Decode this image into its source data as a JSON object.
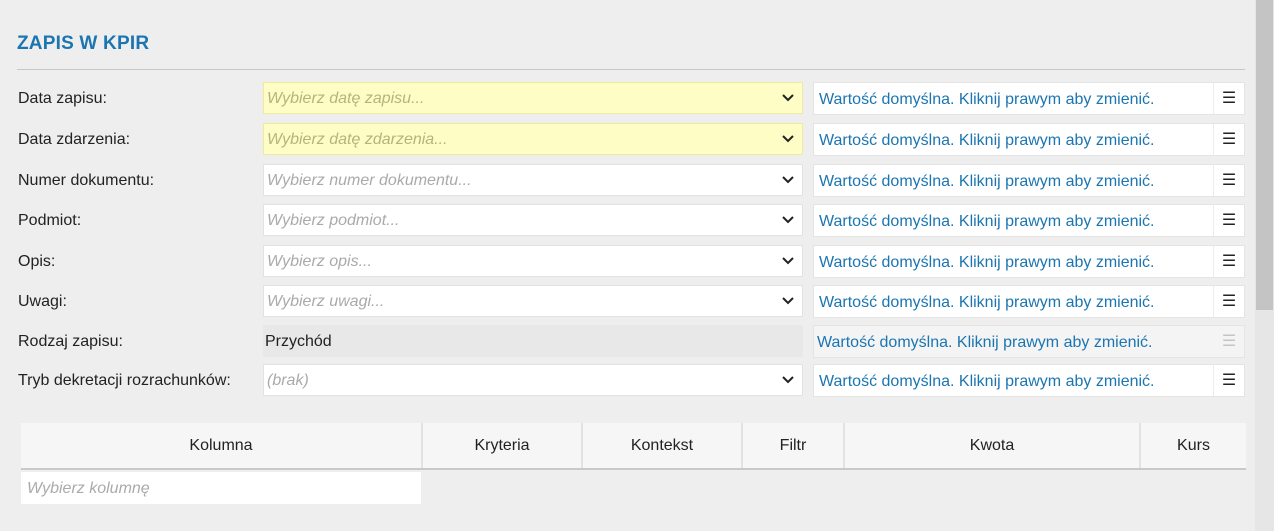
{
  "section": {
    "title": "ZAPIS W KPIR"
  },
  "default_text": "Wartość domyślna. Kliknij prawym aby zmienić.",
  "menu_glyph": "☰",
  "fields": [
    {
      "label": "Data zapisu:",
      "placeholder": "Wybierz datę zapisu..."
    },
    {
      "label": "Data zdarzenia:",
      "placeholder": "Wybierz datę zdarzenia..."
    },
    {
      "label": "Numer dokumentu:",
      "placeholder": "Wybierz numer dokumentu..."
    },
    {
      "label": "Podmiot:",
      "placeholder": "Wybierz podmiot..."
    },
    {
      "label": "Opis:",
      "placeholder": "Wybierz opis..."
    },
    {
      "label": "Uwagi:",
      "placeholder": "Wybierz uwagi..."
    },
    {
      "label": "Rodzaj zapisu:",
      "value": "Przychód"
    },
    {
      "label": "Tryb dekretacji rozrachunków:",
      "placeholder": "(brak)"
    }
  ],
  "grid": {
    "columns": [
      "Kolumna",
      "Kryteria",
      "Kontekst",
      "Filtr",
      "Kwota",
      "Kurs"
    ],
    "column_picker_placeholder": "Wybierz kolumnę"
  }
}
